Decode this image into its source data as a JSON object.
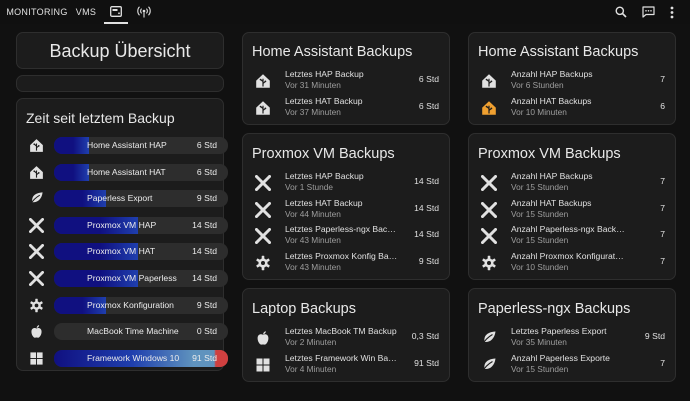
{
  "colors": {
    "bar_dark": "#101080",
    "bar_mid": "#1f3fae",
    "bar_light": "#5f93be",
    "accent_orange": "#f0a030",
    "bar_red": "#d04040"
  },
  "tabs": {
    "monitoring": "MONITORING",
    "vms": "VMS"
  },
  "icons": {
    "tab_backup": "harddisk-icon",
    "tab_network": "access-point-icon",
    "search": "search-icon",
    "chat": "chat-icon",
    "menu": "dots-vertical-icon"
  },
  "overview": {
    "title": "Backup Übersicht"
  },
  "time_since": {
    "title": "Zeit seit letztem Backup",
    "items": [
      {
        "label": "Home Assistant HAP",
        "value": "6 Std",
        "fill": 0.2,
        "icon": "home-assistant-icon"
      },
      {
        "label": "Home Assistant HAT",
        "value": "6 Std",
        "fill": 0.2,
        "icon": "home-assistant-icon"
      },
      {
        "label": "Paperless Export",
        "value": "9 Std",
        "fill": 0.3,
        "icon": "leaf-icon"
      },
      {
        "label": "Proxmox VM HAP",
        "value": "14 Std",
        "fill": 0.48,
        "icon": "proxmox-icon"
      },
      {
        "label": "Proxmox VM HAT",
        "value": "14 Std",
        "fill": 0.48,
        "icon": "proxmox-icon"
      },
      {
        "label": "Proxmox VM Paperless",
        "value": "14 Std",
        "fill": 0.48,
        "icon": "proxmox-icon"
      },
      {
        "label": "Proxmox Konfiguration",
        "value": "9 Std",
        "fill": 0.3,
        "icon": "gear-icon"
      },
      {
        "label": "MacBook Time Machine",
        "value": "0 Std",
        "fill": 0.0,
        "icon": "apple-icon"
      },
      {
        "label": "Framework Windows 10",
        "value": "91 Std",
        "fill": 1.0,
        "icon": "windows-icon"
      }
    ]
  },
  "ha_backups": {
    "title": "Home Assistant Backups",
    "items": [
      {
        "name": "Letztes HAP Backup",
        "sub": "Vor 31 Minuten",
        "value": "6 Std",
        "icon": "home-assistant-icon"
      },
      {
        "name": "Letztes HAT Backup",
        "sub": "Vor 37 Minuten",
        "value": "6 Std",
        "icon": "home-assistant-icon"
      }
    ]
  },
  "proxmox_backups": {
    "title": "Proxmox VM Backups",
    "items": [
      {
        "name": "Letztes HAP Backup",
        "sub": "Vor 1 Stunde",
        "value": "14 Std",
        "icon": "proxmox-icon"
      },
      {
        "name": "Letztes HAT Backup",
        "sub": "Vor 44 Minuten",
        "value": "14 Std",
        "icon": "proxmox-icon"
      },
      {
        "name": "Letztes Paperless-ngx Backup",
        "sub": "Vor 43 Minuten",
        "value": "14 Std",
        "icon": "proxmox-icon"
      },
      {
        "name": "Letztes Proxmox Konfig Backup",
        "sub": "Vor 43 Minuten",
        "value": "9 Std",
        "icon": "gear-icon"
      }
    ]
  },
  "laptop_backups": {
    "title": "Laptop Backups",
    "items": [
      {
        "name": "Letztes MacBook TM Backup",
        "sub": "Vor 2 Minuten",
        "value": "0,3 Std",
        "icon": "apple-icon"
      },
      {
        "name": "Letztes Framework Win Backup",
        "sub": "Vor 4 Minuten",
        "value": "91 Std",
        "icon": "windows-icon"
      }
    ]
  },
  "ha_counts": {
    "title": "Home Assistant Backups",
    "items": [
      {
        "name": "Anzahl HAP Backups",
        "sub": "Vor 6 Stunden",
        "value": "7",
        "icon": "home-assistant-icon"
      },
      {
        "name": "Anzahl HAT Backups",
        "sub": "Vor 10 Minuten",
        "value": "6",
        "icon": "home-assistant-icon"
      }
    ]
  },
  "proxmox_counts": {
    "title": "Proxmox VM Backups",
    "items": [
      {
        "name": "Anzahl HAP Backups",
        "sub": "Vor 15 Stunden",
        "value": "7",
        "icon": "proxmox-icon"
      },
      {
        "name": "Anzahl HAT Backups",
        "sub": "Vor 15 Stunden",
        "value": "7",
        "icon": "proxmox-icon"
      },
      {
        "name": "Anzahl Paperless-ngx Backups",
        "sub": "Vor 15 Stunden",
        "value": "7",
        "icon": "proxmox-icon"
      },
      {
        "name": "Anzahl Proxmox Konfiguration Back…",
        "sub": "Vor 10 Stunden",
        "value": "7",
        "icon": "gear-icon"
      }
    ]
  },
  "paperless_counts": {
    "title": "Paperless-ngx Backups",
    "items": [
      {
        "name": "Letztes Paperless Export",
        "sub": "Vor 35 Minuten",
        "value": "9 Std",
        "icon": "leaf-icon"
      },
      {
        "name": "Anzahl Paperless Exporte",
        "sub": "Vor 15 Stunden",
        "value": "7",
        "icon": "leaf-icon"
      }
    ]
  }
}
